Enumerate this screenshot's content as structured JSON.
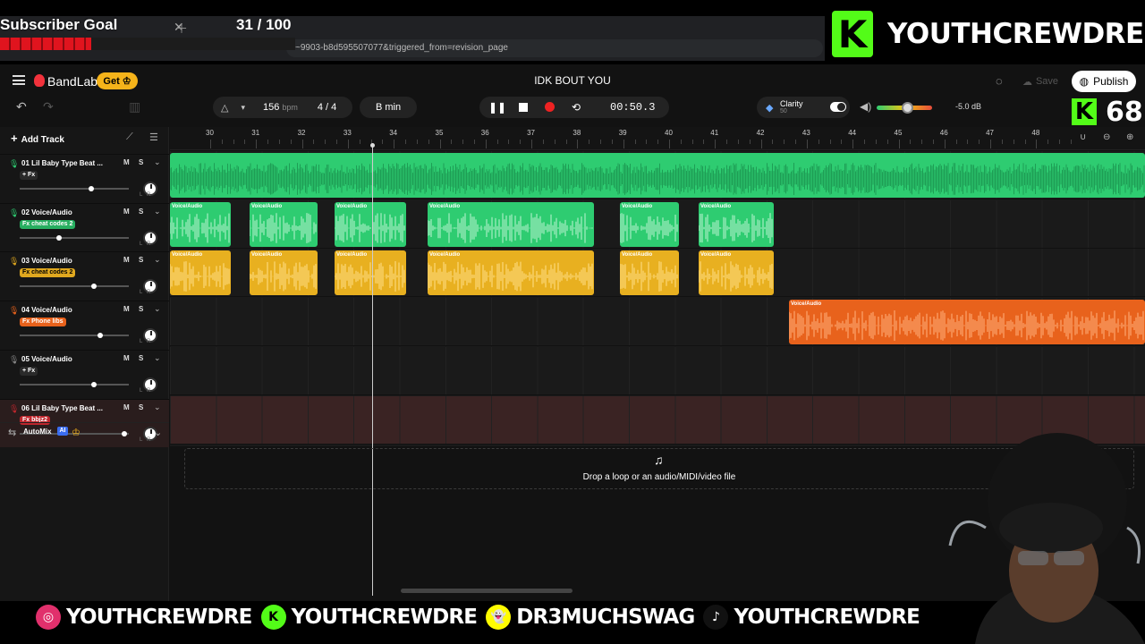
{
  "overlay": {
    "subscriber_goal": {
      "title": "Subscriber Goal",
      "count": "31 / 100",
      "progress": 0.31
    },
    "brand_name": "YOUTHCREWDRE",
    "kick_badge_letter": "K",
    "kick_count": "68",
    "url_text": "~9903-b8d595507077&triggered_from=revision_page",
    "socials": [
      {
        "icon": "instagram-icon",
        "glyph": "◎",
        "color": "#e1306c",
        "handle": "YOUTHCREWDRE"
      },
      {
        "icon": "kick-icon",
        "glyph": "K",
        "color": "#53fc18",
        "handle": "YOUTHCREWDRE"
      },
      {
        "icon": "snapchat-icon",
        "glyph": "👻",
        "color": "#fffc00",
        "handle": "DR3MUCHSWAG"
      },
      {
        "icon": "tiktok-icon",
        "glyph": "♪",
        "color": "#111111",
        "handle": "YOUTHCREWDRE"
      }
    ]
  },
  "header": {
    "app_name": "BandLab",
    "get_label": "Get",
    "project_title": "IDK BOUT YOU",
    "save_label": "Save",
    "publish_label": "Publish"
  },
  "toolbar": {
    "bpm": "156",
    "bpm_unit": "bpm",
    "time_signature": "4 / 4",
    "key": "B min",
    "time": "00:50.3",
    "clarity_label": "Clarity",
    "clarity_value": "50",
    "volume": "-5.0 dB",
    "volume_level": 0.55
  },
  "panel": {
    "add_track_label": "Add Track",
    "automix_label": "AutoMix",
    "ai_badge": "AI"
  },
  "tracks": [
    {
      "name": "01  Lil Baby Type Beat ...",
      "fx": "+ Fx",
      "fx_color": "#2a2a2a",
      "mic_color": "#2ecc71",
      "fader": 0.65,
      "mute": "M",
      "solo": "S"
    },
    {
      "name": "02  Voice/Audio",
      "fx": "Fx cheat codes 2",
      "fx_color": "#27ae60",
      "mic_color": "#2ecc71",
      "fader": 0.35,
      "mute": "M",
      "solo": "S"
    },
    {
      "name": "03  Voice/Audio",
      "fx": "Fx cheat codes 2",
      "fx_color": "#e0a81f",
      "mic_color": "#e0a81f",
      "fader": 0.68,
      "mute": "M",
      "solo": "S"
    },
    {
      "name": "04  Voice/Audio",
      "fx": "Fx Phone libs",
      "fx_color": "#e8621c",
      "mic_color": "#e8621c",
      "fader": 0.74,
      "mute": "M",
      "solo": "S"
    },
    {
      "name": "05  Voice/Audio",
      "fx": "+ Fx",
      "fx_color": "#2a2a2a",
      "mic_color": "#888888",
      "fader": 0.68,
      "mute": "M",
      "solo": "S"
    },
    {
      "name": "06  Lil Baby Type Beat ...",
      "fx": "Fx bbjz2",
      "fx_color": "#c0262d",
      "mic_color": "#c0262d",
      "fader": 0.97,
      "mute": "M",
      "solo": "S"
    }
  ],
  "timeline": {
    "bars": [
      "30",
      "31",
      "32",
      "33",
      "34",
      "35",
      "36",
      "37",
      "38",
      "39",
      "40",
      "41",
      "42",
      "43",
      "44",
      "45",
      "46",
      "47",
      "48"
    ],
    "clip_label": "Voice/Audio",
    "drop_text": "Drop a loop or an audio/MIDI/video file"
  },
  "colors": {
    "green": "#2ecc71",
    "green_dark": "#1e9e55",
    "yellow": "#e8b020",
    "yellow_dark": "#b4861a",
    "orange": "#e8621c",
    "orange_dark": "#b84c14",
    "kick_green": "#53fc18",
    "record_red": "#e22222"
  }
}
